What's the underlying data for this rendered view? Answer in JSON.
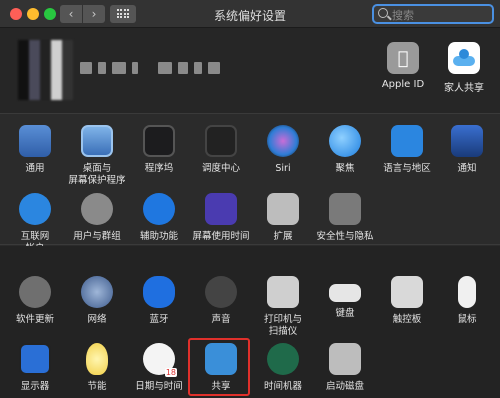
{
  "window": {
    "title": "系统偏好设置",
    "search_placeholder": "搜索"
  },
  "header": {
    "apple_id_label": "Apple ID",
    "family_label": "家人共享"
  },
  "section1": [
    {
      "label": "通用",
      "icon": "general-icon"
    },
    {
      "label": "桌面与\n屏幕保护程序",
      "icon": "desktop-screensaver-icon"
    },
    {
      "label": "程序坞",
      "icon": "dock-icon"
    },
    {
      "label": "调度中心",
      "icon": "mission-control-icon"
    },
    {
      "label": "Siri",
      "icon": "siri-icon"
    },
    {
      "label": "聚焦",
      "icon": "spotlight-icon"
    },
    {
      "label": "语言与地区",
      "icon": "language-region-icon"
    },
    {
      "label": "通知",
      "icon": "notifications-icon"
    },
    {
      "label": "互联网\n帐户",
      "icon": "internet-accounts-icon"
    },
    {
      "label": "用户与群组",
      "icon": "users-groups-icon"
    },
    {
      "label": "辅助功能",
      "icon": "accessibility-icon"
    },
    {
      "label": "屏幕使用时间",
      "icon": "screen-time-icon"
    },
    {
      "label": "扩展",
      "icon": "extensions-icon"
    },
    {
      "label": "安全性与隐私",
      "icon": "security-privacy-icon"
    }
  ],
  "section2": [
    {
      "label": "软件更新",
      "icon": "software-update-icon"
    },
    {
      "label": "网络",
      "icon": "network-icon"
    },
    {
      "label": "蓝牙",
      "icon": "bluetooth-icon"
    },
    {
      "label": "声音",
      "icon": "sound-icon"
    },
    {
      "label": "打印机与\n扫描仪",
      "icon": "printers-scanners-icon"
    },
    {
      "label": "键盘",
      "icon": "keyboard-icon"
    },
    {
      "label": "触控板",
      "icon": "trackpad-icon"
    },
    {
      "label": "鼠标",
      "icon": "mouse-icon"
    },
    {
      "label": "显示器",
      "icon": "displays-icon"
    },
    {
      "label": "节能",
      "icon": "energy-saver-icon"
    },
    {
      "label": "日期与时间",
      "icon": "date-time-icon"
    },
    {
      "label": "共享",
      "icon": "sharing-icon"
    },
    {
      "label": "时间机器",
      "icon": "time-machine-icon"
    },
    {
      "label": "启动磁盘",
      "icon": "startup-disk-icon"
    }
  ],
  "calendar_day": "18"
}
